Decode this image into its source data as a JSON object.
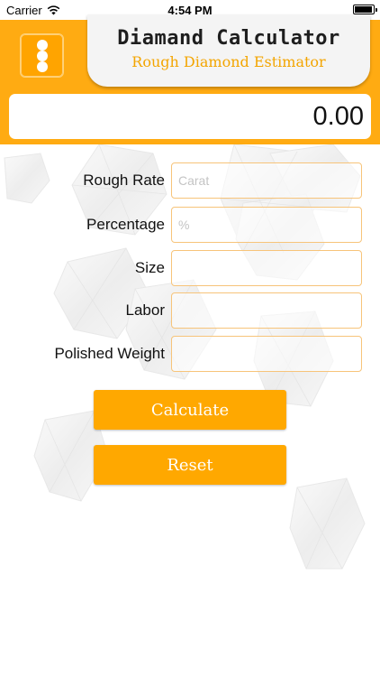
{
  "status_bar": {
    "carrier": "Carrier",
    "time": "4:54 PM"
  },
  "header": {
    "title": "Diamand Calculator",
    "subtitle": "Rough Diamond Estimator",
    "display_value": "0.00"
  },
  "form": {
    "fields": [
      {
        "label": "Rough Rate",
        "placeholder": "Carat",
        "value": ""
      },
      {
        "label": "Percentage",
        "placeholder": "%",
        "value": ""
      },
      {
        "label": "Size",
        "placeholder": "",
        "value": ""
      },
      {
        "label": "Labor",
        "placeholder": "",
        "value": ""
      },
      {
        "label": "Polished Weight",
        "placeholder": "",
        "value": ""
      }
    ]
  },
  "buttons": {
    "calculate": "Calculate",
    "reset": "Reset"
  },
  "colors": {
    "accent": "#ffab12",
    "button": "#ffa800",
    "subtitle": "#f3a500",
    "field_border": "#f7c47a"
  },
  "icons": {
    "menu": "three-dots-vertical-icon",
    "wifi": "wifi-icon",
    "battery": "battery-icon"
  }
}
